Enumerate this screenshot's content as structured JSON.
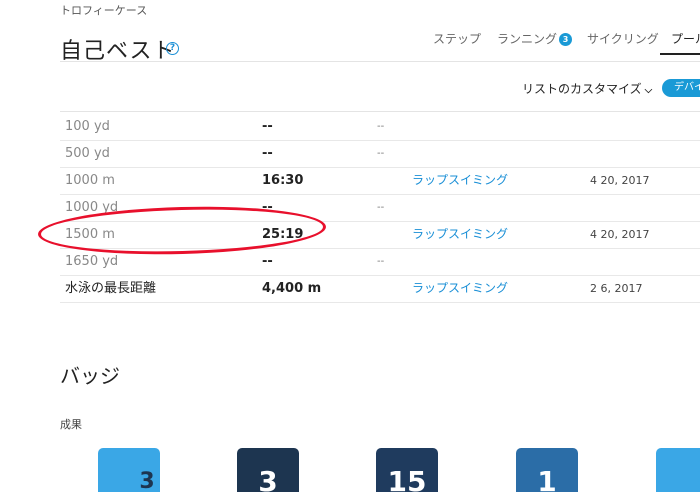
{
  "breadcrumb": "トロフィーケース",
  "page_title": "自己ベスト",
  "help_icon": "?",
  "tabs": [
    {
      "label": "ステップ"
    },
    {
      "label": "ランニング",
      "badge": "3"
    },
    {
      "label": "サイクリング"
    },
    {
      "label": "プール"
    }
  ],
  "customize_label": "リストのカスタマイズ",
  "device_button": "デバイ",
  "records": [
    {
      "name": "100 yd",
      "time": "--",
      "dash": "--",
      "activity": "",
      "date": ""
    },
    {
      "name": "500 yd",
      "time": "--",
      "dash": "--",
      "activity": "",
      "date": ""
    },
    {
      "name": "1000 m",
      "time": "16:30",
      "dash": "",
      "activity": "ラップスイミング",
      "date": "4 20, 2017"
    },
    {
      "name": "1000 yd",
      "time": "--",
      "dash": "--",
      "activity": "",
      "date": ""
    },
    {
      "name": "1500 m",
      "time": "25:19",
      "dash": "",
      "activity": "ラップスイミング",
      "date": "4 20, 2017"
    },
    {
      "name": "1650 yd",
      "time": "--",
      "dash": "--",
      "activity": "",
      "date": ""
    },
    {
      "name": "水泳の最長距離",
      "time": "4,400 m",
      "dash": "",
      "activity": "ラップスイミング",
      "date": "2 6, 2017"
    }
  ],
  "badges_title": "バッジ",
  "achievements_label": "成果",
  "badge_numbers": [
    "3",
    "3",
    "15",
    "1",
    ""
  ],
  "colors": {
    "accent": "#1a9ad6",
    "highlight": "#e8102c"
  }
}
